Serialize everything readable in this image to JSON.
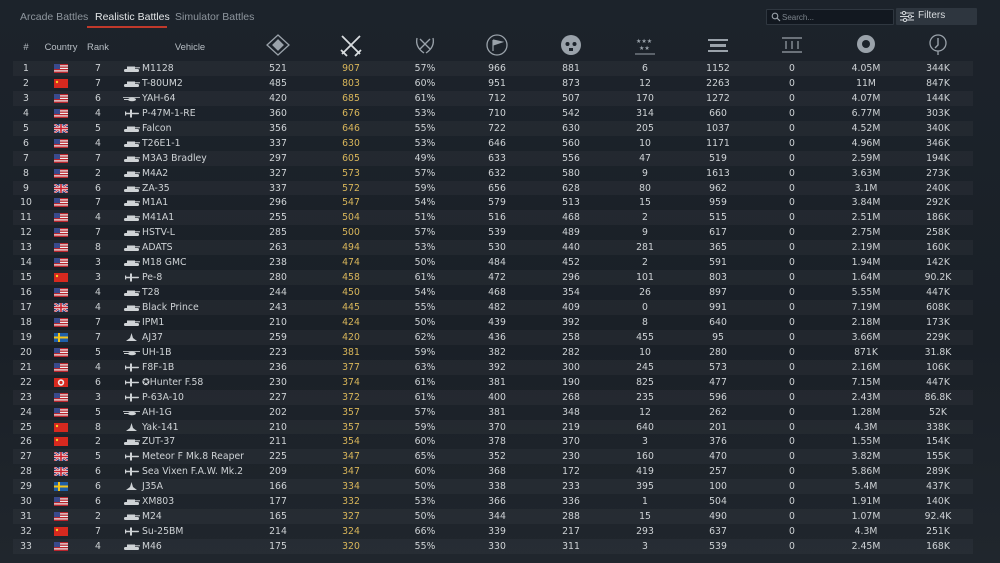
{
  "tabs": [
    {
      "label": "Arcade Battles",
      "active": false
    },
    {
      "label": "Realistic Battles",
      "active": true
    },
    {
      "label": "Simulator Battles",
      "active": false
    }
  ],
  "search": {
    "placeholder": "Search..."
  },
  "filters": {
    "label": "Filters"
  },
  "colors": {
    "accent": "#c0392b",
    "highlight": "#d9b65a",
    "background": "#1c232b"
  },
  "header": {
    "num": "#",
    "country": "Country",
    "rank": "Rank",
    "vehicle": "Vehicle"
  },
  "stat_icons": [
    "battles-icon",
    "crossed-swords-icon",
    "victory-wreath-icon",
    "flag-icon",
    "skull-icon",
    "stars-icon",
    "ground-kills-icon",
    "naval-kills-icon",
    "lion-icon",
    "research-icon"
  ],
  "rows": [
    {
      "n": "1",
      "c": "us",
      "flag": "us-flag-icon",
      "rank": "7",
      "type": "tank",
      "vehicle": "M1128",
      "battles": "521",
      "kills": "907",
      "win": "57%",
      "s4": "966",
      "s5": "881",
      "s6": "6",
      "s7": "1152",
      "s8": "0",
      "s9": "4.05M",
      "s10": "344K"
    },
    {
      "n": "2",
      "c": "cn",
      "flag": "china-flag-icon",
      "rank": "7",
      "type": "tank",
      "vehicle": "T-80UM2",
      "battles": "485",
      "kills": "803",
      "win": "60%",
      "s4": "951",
      "s5": "873",
      "s6": "12",
      "s7": "2263",
      "s8": "0",
      "s9": "11M",
      "s10": "847K"
    },
    {
      "n": "3",
      "c": "us",
      "flag": "us-flag-icon",
      "rank": "6",
      "type": "heli",
      "vehicle": "YAH-64",
      "battles": "420",
      "kills": "685",
      "win": "61%",
      "s4": "712",
      "s5": "507",
      "s6": "170",
      "s7": "1272",
      "s8": "0",
      "s9": "4.07M",
      "s10": "144K"
    },
    {
      "n": "4",
      "c": "us",
      "flag": "us-flag-icon",
      "rank": "4",
      "type": "plane",
      "vehicle": "P-47M-1-RE",
      "battles": "360",
      "kills": "676",
      "win": "53%",
      "s4": "710",
      "s5": "542",
      "s6": "314",
      "s7": "660",
      "s8": "0",
      "s9": "6.77M",
      "s10": "303K"
    },
    {
      "n": "5",
      "c": "uk",
      "flag": "uk-flag-icon",
      "rank": "5",
      "type": "tank",
      "vehicle": "Falcon",
      "battles": "356",
      "kills": "646",
      "win": "55%",
      "s4": "722",
      "s5": "630",
      "s6": "205",
      "s7": "1037",
      "s8": "0",
      "s9": "4.52M",
      "s10": "340K"
    },
    {
      "n": "6",
      "c": "us",
      "flag": "us-flag-icon",
      "rank": "4",
      "type": "tank",
      "vehicle": "T26E1-1",
      "battles": "337",
      "kills": "630",
      "win": "53%",
      "s4": "646",
      "s5": "560",
      "s6": "10",
      "s7": "1171",
      "s8": "0",
      "s9": "4.96M",
      "s10": "346K"
    },
    {
      "n": "7",
      "c": "us",
      "flag": "us-flag-icon",
      "rank": "7",
      "type": "tank",
      "vehicle": "M3A3 Bradley",
      "battles": "297",
      "kills": "605",
      "win": "49%",
      "s4": "633",
      "s5": "556",
      "s6": "47",
      "s7": "519",
      "s8": "0",
      "s9": "2.59M",
      "s10": "194K"
    },
    {
      "n": "8",
      "c": "us",
      "flag": "us-flag-icon",
      "rank": "2",
      "type": "tank",
      "vehicle": "M4A2",
      "battles": "327",
      "kills": "573",
      "win": "57%",
      "s4": "632",
      "s5": "580",
      "s6": "9",
      "s7": "1613",
      "s8": "0",
      "s9": "3.63M",
      "s10": "273K"
    },
    {
      "n": "9",
      "c": "uk",
      "flag": "uk-flag-icon",
      "rank": "6",
      "type": "tank",
      "vehicle": "ZA-35",
      "battles": "337",
      "kills": "572",
      "win": "59%",
      "s4": "656",
      "s5": "628",
      "s6": "80",
      "s7": "962",
      "s8": "0",
      "s9": "3.1M",
      "s10": "240K"
    },
    {
      "n": "10",
      "c": "us",
      "flag": "us-flag-icon",
      "rank": "7",
      "type": "tank",
      "vehicle": "M1A1",
      "battles": "296",
      "kills": "547",
      "win": "54%",
      "s4": "579",
      "s5": "513",
      "s6": "15",
      "s7": "959",
      "s8": "0",
      "s9": "3.84M",
      "s10": "292K"
    },
    {
      "n": "11",
      "c": "us",
      "flag": "us-flag-icon",
      "rank": "4",
      "type": "tank",
      "vehicle": "M41A1",
      "battles": "255",
      "kills": "504",
      "win": "51%",
      "s4": "516",
      "s5": "468",
      "s6": "2",
      "s7": "515",
      "s8": "0",
      "s9": "2.51M",
      "s10": "186K"
    },
    {
      "n": "12",
      "c": "us",
      "flag": "us-flag-icon",
      "rank": "7",
      "type": "tank",
      "vehicle": "HSTV-L",
      "battles": "285",
      "kills": "500",
      "win": "57%",
      "s4": "539",
      "s5": "489",
      "s6": "9",
      "s7": "617",
      "s8": "0",
      "s9": "2.75M",
      "s10": "258K"
    },
    {
      "n": "13",
      "c": "us",
      "flag": "us-flag-icon",
      "rank": "8",
      "type": "tank",
      "vehicle": "ADATS",
      "battles": "263",
      "kills": "494",
      "win": "53%",
      "s4": "530",
      "s5": "440",
      "s6": "281",
      "s7": "365",
      "s8": "0",
      "s9": "2.19M",
      "s10": "160K"
    },
    {
      "n": "14",
      "c": "us",
      "flag": "us-flag-icon",
      "rank": "3",
      "type": "tank",
      "vehicle": "M18 GMC",
      "battles": "238",
      "kills": "474",
      "win": "50%",
      "s4": "484",
      "s5": "452",
      "s6": "2",
      "s7": "591",
      "s8": "0",
      "s9": "1.94M",
      "s10": "142K"
    },
    {
      "n": "15",
      "c": "cn",
      "flag": "china-flag-icon",
      "rank": "3",
      "type": "plane",
      "vehicle": "Pe-8",
      "battles": "280",
      "kills": "458",
      "win": "61%",
      "s4": "472",
      "s5": "296",
      "s6": "101",
      "s7": "803",
      "s8": "0",
      "s9": "1.64M",
      "s10": "90.2K"
    },
    {
      "n": "16",
      "c": "us",
      "flag": "us-flag-icon",
      "rank": "4",
      "type": "tank",
      "vehicle": "T28",
      "battles": "244",
      "kills": "450",
      "win": "54%",
      "s4": "468",
      "s5": "354",
      "s6": "26",
      "s7": "897",
      "s8": "0",
      "s9": "5.55M",
      "s10": "447K"
    },
    {
      "n": "17",
      "c": "uk",
      "flag": "uk-flag-icon",
      "rank": "4",
      "type": "tank",
      "vehicle": "Black Prince",
      "battles": "243",
      "kills": "445",
      "win": "55%",
      "s4": "482",
      "s5": "409",
      "s6": "0",
      "s7": "991",
      "s8": "0",
      "s9": "7.19M",
      "s10": "608K"
    },
    {
      "n": "18",
      "c": "us",
      "flag": "us-flag-icon",
      "rank": "7",
      "type": "tank",
      "vehicle": "IPM1",
      "battles": "210",
      "kills": "424",
      "win": "50%",
      "s4": "439",
      "s5": "392",
      "s6": "8",
      "s7": "640",
      "s8": "0",
      "s9": "2.18M",
      "s10": "173K"
    },
    {
      "n": "19",
      "c": "se",
      "flag": "sweden-flag-icon",
      "rank": "7",
      "type": "jet",
      "vehicle": "AJ37",
      "battles": "259",
      "kills": "420",
      "win": "62%",
      "s4": "436",
      "s5": "258",
      "s6": "455",
      "s7": "95",
      "s8": "0",
      "s9": "3.66M",
      "s10": "229K"
    },
    {
      "n": "20",
      "c": "us",
      "flag": "us-flag-icon",
      "rank": "5",
      "type": "heli",
      "vehicle": "UH-1B",
      "battles": "223",
      "kills": "381",
      "win": "59%",
      "s4": "382",
      "s5": "282",
      "s6": "10",
      "s7": "280",
      "s8": "0",
      "s9": "871K",
      "s10": "31.8K"
    },
    {
      "n": "21",
      "c": "us",
      "flag": "us-flag-icon",
      "rank": "4",
      "type": "plane",
      "vehicle": "F8F-1B",
      "battles": "236",
      "kills": "377",
      "win": "63%",
      "s4": "392",
      "s5": "300",
      "s6": "245",
      "s7": "573",
      "s8": "0",
      "s9": "2.16M",
      "s10": "106K"
    },
    {
      "n": "22",
      "c": "il",
      "flag": "israel-flag-icon",
      "rank": "6",
      "type": "plane",
      "vehicle": "✪Hunter F.58",
      "battles": "230",
      "kills": "374",
      "win": "61%",
      "s4": "381",
      "s5": "190",
      "s6": "825",
      "s7": "477",
      "s8": "0",
      "s9": "7.15M",
      "s10": "447K"
    },
    {
      "n": "23",
      "c": "us",
      "flag": "us-flag-icon",
      "rank": "3",
      "type": "plane",
      "vehicle": "P-63A-10",
      "battles": "227",
      "kills": "372",
      "win": "61%",
      "s4": "400",
      "s5": "268",
      "s6": "235",
      "s7": "596",
      "s8": "0",
      "s9": "2.43M",
      "s10": "86.8K"
    },
    {
      "n": "24",
      "c": "us",
      "flag": "us-flag-icon",
      "rank": "5",
      "type": "heli",
      "vehicle": "AH-1G",
      "battles": "202",
      "kills": "357",
      "win": "57%",
      "s4": "381",
      "s5": "348",
      "s6": "12",
      "s7": "262",
      "s8": "0",
      "s9": "1.28M",
      "s10": "52K"
    },
    {
      "n": "25",
      "c": "cn",
      "flag": "china-flag-icon",
      "rank": "8",
      "type": "jet",
      "vehicle": "Yak-141",
      "battles": "210",
      "kills": "357",
      "win": "59%",
      "s4": "370",
      "s5": "219",
      "s6": "640",
      "s7": "201",
      "s8": "0",
      "s9": "4.3M",
      "s10": "338K"
    },
    {
      "n": "26",
      "c": "cn",
      "flag": "china-flag-icon",
      "rank": "2",
      "type": "tank",
      "vehicle": "ZUT-37",
      "battles": "211",
      "kills": "354",
      "win": "60%",
      "s4": "378",
      "s5": "370",
      "s6": "3",
      "s7": "376",
      "s8": "0",
      "s9": "1.55M",
      "s10": "154K"
    },
    {
      "n": "27",
      "c": "uk",
      "flag": "uk-flag-icon",
      "rank": "5",
      "type": "plane",
      "vehicle": "Meteor F Mk.8 Reaper",
      "battles": "225",
      "kills": "347",
      "win": "65%",
      "s4": "352",
      "s5": "230",
      "s6": "160",
      "s7": "470",
      "s8": "0",
      "s9": "3.82M",
      "s10": "155K"
    },
    {
      "n": "28",
      "c": "uk",
      "flag": "uk-flag-icon",
      "rank": "6",
      "type": "plane",
      "vehicle": "Sea Vixen F.A.W. Mk.2",
      "battles": "209",
      "kills": "347",
      "win": "60%",
      "s4": "368",
      "s5": "172",
      "s6": "419",
      "s7": "257",
      "s8": "0",
      "s9": "5.86M",
      "s10": "289K"
    },
    {
      "n": "29",
      "c": "se",
      "flag": "sweden-flag-icon",
      "rank": "6",
      "type": "jet",
      "vehicle": "J35A",
      "battles": "166",
      "kills": "334",
      "win": "50%",
      "s4": "338",
      "s5": "233",
      "s6": "395",
      "s7": "100",
      "s8": "0",
      "s9": "5.4M",
      "s10": "437K"
    },
    {
      "n": "30",
      "c": "us",
      "flag": "us-flag-icon",
      "rank": "6",
      "type": "tank",
      "vehicle": "XM803",
      "battles": "177",
      "kills": "332",
      "win": "53%",
      "s4": "366",
      "s5": "336",
      "s6": "1",
      "s7": "504",
      "s8": "0",
      "s9": "1.91M",
      "s10": "140K"
    },
    {
      "n": "31",
      "c": "us",
      "flag": "us-flag-icon",
      "rank": "2",
      "type": "tank",
      "vehicle": "M24",
      "battles": "165",
      "kills": "327",
      "win": "50%",
      "s4": "344",
      "s5": "288",
      "s6": "15",
      "s7": "490",
      "s8": "0",
      "s9": "1.07M",
      "s10": "92.4K"
    },
    {
      "n": "32",
      "c": "cn",
      "flag": "china-flag-icon",
      "rank": "7",
      "type": "plane",
      "vehicle": "Su-25BM",
      "battles": "214",
      "kills": "324",
      "win": "66%",
      "s4": "339",
      "s5": "217",
      "s6": "293",
      "s7": "637",
      "s8": "0",
      "s9": "4.3M",
      "s10": "251K"
    },
    {
      "n": "33",
      "c": "us",
      "flag": "us-flag-icon",
      "rank": "4",
      "type": "tank",
      "vehicle": "M46",
      "battles": "175",
      "kills": "320",
      "win": "55%",
      "s4": "330",
      "s5": "311",
      "s6": "3",
      "s7": "539",
      "s8": "0",
      "s9": "2.45M",
      "s10": "168K"
    }
  ]
}
